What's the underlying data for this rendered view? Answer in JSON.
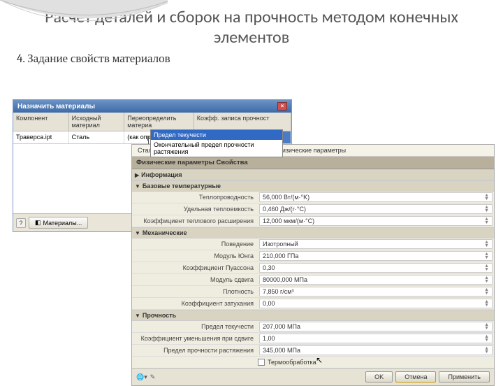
{
  "slide": {
    "title": "Расчет деталей и сборок на прочность методом конечных элементов",
    "subtitle": "4. Задание свойств материалов"
  },
  "win1": {
    "title": "Назначить материалы",
    "columns": [
      "Компонент",
      "Исходный материал",
      "Переопределить материа",
      "Коэфф. записа прочност"
    ],
    "row": {
      "c1": "Траверса.ipt",
      "c2": "Сталь",
      "c3": "(как определено)",
      "c4": "Предел текучести"
    },
    "dropdown": [
      "Предел текучести",
      "Окончательный предел прочности растяжения"
    ],
    "materials_btn": "Материалы..."
  },
  "win2": {
    "top_left": "Сталь",
    "top_right": "Физические параметры",
    "subtitle": "Физические параметры Свойства",
    "sections": {
      "info": "Информация",
      "base_temp": "Базовые температурные",
      "mech": "Механические",
      "strength": "Прочность"
    },
    "base_temp": [
      {
        "label": "Теплопроводность",
        "val": "56,000 Вт/(м·°K)"
      },
      {
        "label": "Удельная теплоемкость",
        "val": "0,460 Дж/(г·°C)"
      },
      {
        "label": "Коэффициент теплового расширения",
        "val": "12,000 мкм/(м·°C)"
      }
    ],
    "mech": [
      {
        "label": "Поведение",
        "val": "Изотропный"
      },
      {
        "label": "Модуль Юнга",
        "val": "210,000 ГПа"
      },
      {
        "label": "Коэффициент Пуассона",
        "val": "0,30"
      },
      {
        "label": "Модуль сдвига",
        "val": "80000,000 МПа"
      },
      {
        "label": "Плотность",
        "val": "7,850 г/см³"
      },
      {
        "label": "Коэффициент затухания",
        "val": "0,00"
      }
    ],
    "strength": [
      {
        "label": "Предел текучести",
        "val": "207,000 МПа"
      },
      {
        "label": "Коэффициент уменьшения при сдвиге",
        "val": "1,00"
      },
      {
        "label": "Предел прочности растяжения",
        "val": "345,000 МПа"
      }
    ],
    "checkbox": "Термообработка",
    "footer": {
      "ok": "OK",
      "cancel": "Отмена",
      "apply": "Применить"
    }
  }
}
